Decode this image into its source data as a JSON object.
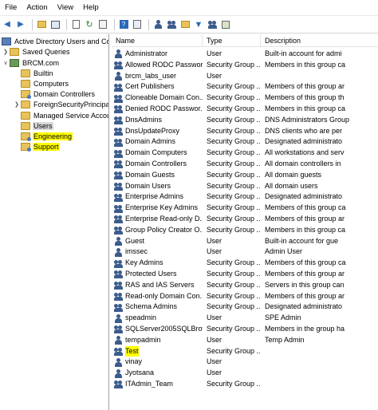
{
  "menubar": {
    "items": [
      "File",
      "Action",
      "View",
      "Help"
    ]
  },
  "toolbar": {
    "icons": [
      "back-icon",
      "forward-icon",
      "up-folder-icon",
      "show-tree-icon",
      "copy-icon",
      "refresh-icon",
      "export-icon",
      "help-icon",
      "properties-icon",
      "new-user-icon",
      "new-group-icon",
      "new-ou-icon",
      "filter-icon",
      "add-to-group-icon",
      "delegate-icon"
    ]
  },
  "tree": {
    "root": "Active Directory Users and Comp",
    "items": [
      {
        "label": "Saved Queries"
      },
      {
        "label": "BRCM.com"
      },
      {
        "label": "Builtin"
      },
      {
        "label": "Computers"
      },
      {
        "label": "Domain Controllers"
      },
      {
        "label": "ForeignSecurityPrincipals"
      },
      {
        "label": "Managed Service Accoun"
      },
      {
        "label": "Users"
      },
      {
        "label": "Engineering"
      },
      {
        "label": "Support"
      }
    ]
  },
  "list": {
    "columns": [
      "Name",
      "Type",
      "Description"
    ],
    "rows": [
      {
        "name": "Administrator",
        "type": "User",
        "desc": "Built-in account for admi",
        "icon": "user"
      },
      {
        "name": "Allowed RODC Passwor...",
        "type": "Security Group ...",
        "desc": "Members in this group ca",
        "icon": "group"
      },
      {
        "name": "brcm_labs_user",
        "type": "User",
        "desc": "",
        "icon": "user"
      },
      {
        "name": "Cert Publishers",
        "type": "Security Group ...",
        "desc": "Members of this group ar",
        "icon": "group"
      },
      {
        "name": "Cloneable Domain Con...",
        "type": "Security Group ...",
        "desc": "Members of this group th",
        "icon": "group"
      },
      {
        "name": "Denied RODC Passwor...",
        "type": "Security Group ...",
        "desc": "Members in this group ca",
        "icon": "group"
      },
      {
        "name": "DnsAdmins",
        "type": "Security Group ...",
        "desc": "DNS Administrators Group",
        "icon": "group"
      },
      {
        "name": "DnsUpdateProxy",
        "type": "Security Group ...",
        "desc": "DNS clients who are per",
        "icon": "group"
      },
      {
        "name": "Domain Admins",
        "type": "Security Group ...",
        "desc": "Designated administrato",
        "icon": "group"
      },
      {
        "name": "Domain Computers",
        "type": "Security Group ...",
        "desc": "All workstations and serv",
        "icon": "group"
      },
      {
        "name": "Domain Controllers",
        "type": "Security Group ...",
        "desc": "All domain controllers in",
        "icon": "group"
      },
      {
        "name": "Domain Guests",
        "type": "Security Group ...",
        "desc": "All domain guests",
        "icon": "group"
      },
      {
        "name": "Domain Users",
        "type": "Security Group ...",
        "desc": "All domain users",
        "icon": "group"
      },
      {
        "name": "Enterprise Admins",
        "type": "Security Group ...",
        "desc": "Designated administrato",
        "icon": "group"
      },
      {
        "name": "Enterprise Key Admins",
        "type": "Security Group ...",
        "desc": "Members of this group ca",
        "icon": "group"
      },
      {
        "name": "Enterprise Read-only D...",
        "type": "Security Group ...",
        "desc": "Members of this group ar",
        "icon": "group"
      },
      {
        "name": "Group Policy Creator O...",
        "type": "Security Group ...",
        "desc": "Members in this group ca",
        "icon": "group"
      },
      {
        "name": "Guest",
        "type": "User",
        "desc": "Built-in account for gue",
        "icon": "user"
      },
      {
        "name": "imssec",
        "type": "User",
        "desc": "Admin User",
        "icon": "user"
      },
      {
        "name": "Key Admins",
        "type": "Security Group ...",
        "desc": "Members of this group ca",
        "icon": "group"
      },
      {
        "name": "Protected Users",
        "type": "Security Group ...",
        "desc": "Members of this group ar",
        "icon": "group"
      },
      {
        "name": "RAS and IAS Servers",
        "type": "Security Group ...",
        "desc": "Servers in this group can",
        "icon": "group"
      },
      {
        "name": "Read-only Domain Con...",
        "type": "Security Group ...",
        "desc": "Members of this group ar",
        "icon": "group"
      },
      {
        "name": "Schema Admins",
        "type": "Security Group ...",
        "desc": "Designated administrato",
        "icon": "group"
      },
      {
        "name": "speadmin",
        "type": "User",
        "desc": "SPE Admin",
        "icon": "user"
      },
      {
        "name": "SQLServer2005SQLBrow...",
        "type": "Security Group ...",
        "desc": "Members in the group ha",
        "icon": "group"
      },
      {
        "name": "tempadmin",
        "type": "User",
        "desc": "Temp Admin",
        "icon": "user"
      },
      {
        "name": "Test",
        "type": "Security Group ...",
        "desc": "",
        "icon": "group",
        "highlight": true
      },
      {
        "name": "vinay",
        "type": "User",
        "desc": "",
        "icon": "user"
      },
      {
        "name": "Jyotsana",
        "type": "User",
        "desc": "",
        "icon": "user"
      },
      {
        "name": "ITAdmin_Team",
        "type": "Security Group ...",
        "desc": "",
        "icon": "group"
      }
    ]
  },
  "colors": {
    "highlight": "#ffff00",
    "selected": "#d9d9d9",
    "folder": "#e8c25a",
    "icon_blue": "#3b5c8c"
  }
}
